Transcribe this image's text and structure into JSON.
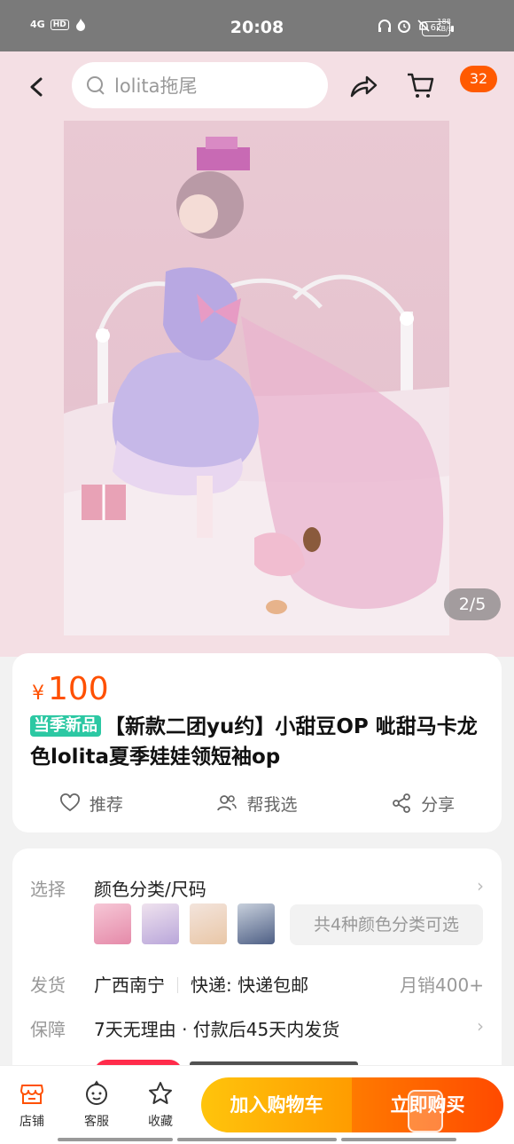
{
  "status_bar": {
    "network": "4G",
    "hd": "HD",
    "time": "20:08",
    "speed_value": "188",
    "speed_unit": "KB/s",
    "battery": "62"
  },
  "header": {
    "search_text": "lolita拖尾",
    "cart_badge": "32"
  },
  "gallery": {
    "counter": "2/5"
  },
  "product": {
    "currency": "¥",
    "price": "100",
    "new_tag": "当季新品",
    "title": "【新款二团yu约】小甜豆OP 呲甜马卡龙色lolita夏季娃娃领短袖op",
    "actions": [
      "推荐",
      "帮我选",
      "分享"
    ]
  },
  "detail": {
    "select_label": "选择",
    "select_value": "颜色分类/尺码",
    "choice_count": "共4种颜色分类可选",
    "ship_label": "发货",
    "ship_from": "广西南宁",
    "express": "快递: 快递包邮",
    "monthly_sales": "月销400+",
    "guarantee_label": "保障",
    "guarantee_value": "7天无理由 · 付款后45天内发货"
  },
  "bottom_bar": {
    "tabs": [
      "店铺",
      "客服",
      "收藏"
    ],
    "add_to_cart": "加入购物车",
    "buy_now": "立即购买"
  },
  "colors": {
    "accent_orange": "#ff5000",
    "new_tag_green": "#2cc8a3",
    "cart_yellow": "#ffb000",
    "header_pink": "#f4dfe4"
  }
}
